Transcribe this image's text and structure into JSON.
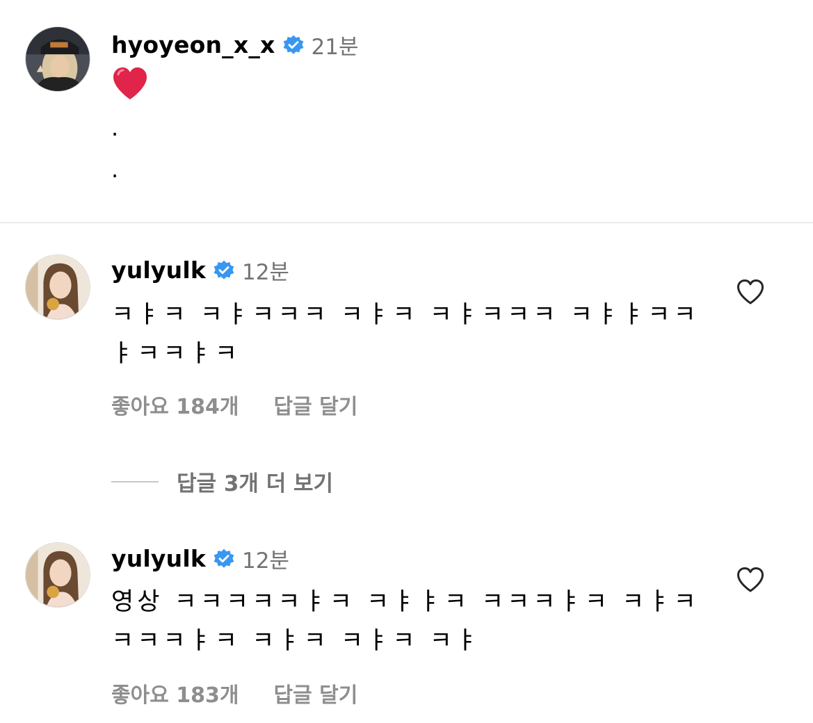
{
  "colors": {
    "verified_badge": "#3897f0",
    "heart": "#e0244a",
    "muted_text": "#8e8e8e",
    "divider": "#dbdbdb"
  },
  "post": {
    "username": "hyoyeon_x_x",
    "verified": true,
    "time": "21분",
    "caption_icon": "red-heart-emoji",
    "caption_lines": [
      ".",
      "."
    ]
  },
  "comments": [
    {
      "username": "yulyulk",
      "verified": true,
      "time": "12분",
      "text": "ㅋㅑㅋ ㅋㅑㅋㅋㅋ ㅋㅑㅋ ㅋㅑㅋㅋㅋ ㅋㅑㅑㅋㅋ ㅑㅋㅋㅑㅋ",
      "likes": "좋아요 184개",
      "reply_label": "답글 달기",
      "like_icon": "heart-outline-icon"
    },
    {
      "username": "yulyulk",
      "verified": true,
      "time": "12분",
      "text": "영상 ㅋㅋㅋㅋㅋㅑㅋ ㅋㅑㅑㅋ ㅋㅋㅋㅑㅋ ㅋㅑㅋ ㅋㅋㅋㅑㅋ ㅋㅑㅋ ㅋㅑㅋ ㅋㅑ",
      "likes": "좋아요 183개",
      "reply_label": "답글 달기",
      "like_icon": "heart-outline-icon"
    }
  ],
  "view_more_replies": "답글 3개 더 보기"
}
